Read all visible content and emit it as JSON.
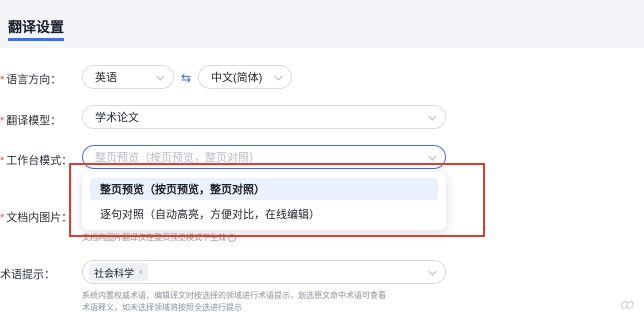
{
  "header": {
    "title": "翻译设置"
  },
  "language": {
    "label": "语言方向：",
    "source": "英语",
    "target": "中文(简体)",
    "swap_icon": "swap-arrows-icon"
  },
  "model": {
    "label": "翻译模型：",
    "value": "学术论文"
  },
  "workbench": {
    "label": "工作台模式：",
    "placeholder": "整页预览（按页预览，整页对照）",
    "options": [
      "整页预览（按页预览，整页对照）",
      "逐句对照（自动高亮，方便对比，在线编辑）"
    ]
  },
  "doc_image": {
    "label": "文档内图片：",
    "hint": "文档内图片翻译仅在整页预览模式下生效"
  },
  "terms": {
    "label": "术语提示：",
    "tag": "社会科学",
    "tag_close": "×",
    "hint_line1": "系统内置权威术语，编辑译文时按选择的领域进行术语提示，划选原文命中术语可查看",
    "hint_line2": "术语释义，如未选择领域将按照全选进行提示"
  },
  "required_mark": "*",
  "colors": {
    "accent": "#3b6df6",
    "required": "#f04a3a",
    "highlight": "#e8392f"
  }
}
